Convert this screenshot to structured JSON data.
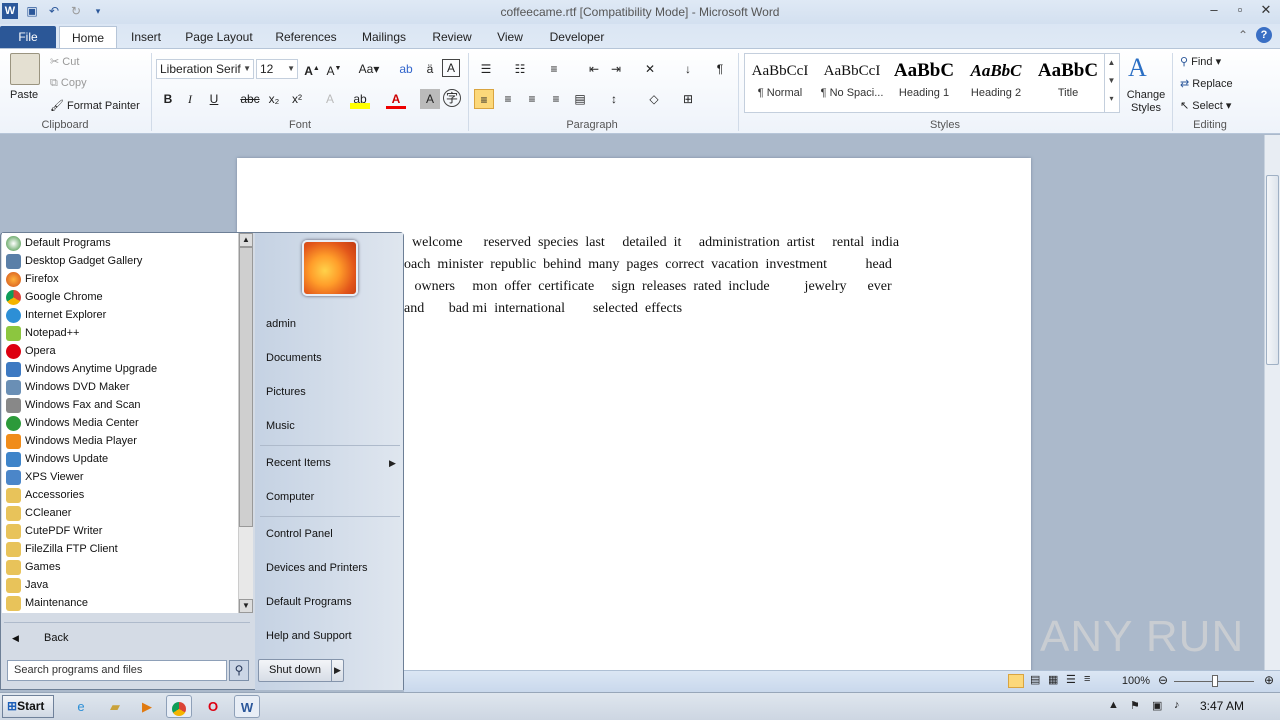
{
  "window": {
    "title": "coffeecame.rtf [Compatibility Mode] - Microsoft Word"
  },
  "tabs": [
    "File",
    "Home",
    "Insert",
    "Page Layout",
    "References",
    "Mailings",
    "Review",
    "View",
    "Developer"
  ],
  "clipboard": {
    "paste": "Paste",
    "cut": "Cut",
    "copy": "Copy",
    "format_painter": "Format Painter",
    "label": "Clipboard"
  },
  "font": {
    "name": "Liberation Serif",
    "size": "12",
    "label": "Font"
  },
  "paragraph": {
    "label": "Paragraph"
  },
  "styles": {
    "label": "Styles",
    "items": [
      {
        "preview": "AaBbCcI",
        "name": "¶ Normal"
      },
      {
        "preview": "AaBbCcI",
        "name": "¶ No Spaci..."
      },
      {
        "preview": "AaBbC",
        "name": "Heading 1"
      },
      {
        "preview": "AaBbC",
        "name": "Heading 2"
      },
      {
        "preview": "AaBbC",
        "name": "Title"
      }
    ],
    "change": "Change Styles"
  },
  "editing": {
    "label": "Editing",
    "find": "Find",
    "replace": "Replace",
    "select": "Select"
  },
  "document": {
    "lines": [
      "welcome      reserved  species  last     detailed  it     administration  artist     rental  india",
      "oach  minister  republic  behind  many  pages  correct  vacation  investment           head",
      "   owners     mon  offer  certificate     sign  releases  rated  include          jewelry      ever",
      "and       bad mi  international        selected  effects"
    ]
  },
  "status": {
    "zoom": "100%"
  },
  "start_menu": {
    "programs": [
      "Default Programs",
      "Desktop Gadget Gallery",
      "Firefox",
      "Google Chrome",
      "Internet Explorer",
      "Notepad++",
      "Opera",
      "Windows Anytime Upgrade",
      "Windows DVD Maker",
      "Windows Fax and Scan",
      "Windows Media Center",
      "Windows Media Player",
      "Windows Update",
      "XPS Viewer",
      "Accessories",
      "CCleaner",
      "CutePDF Writer",
      "FileZilla FTP Client",
      "Games",
      "Java",
      "Maintenance"
    ],
    "back": "Back",
    "search_placeholder": "Search programs and files",
    "right": [
      "admin",
      "Documents",
      "Pictures",
      "Music",
      "Recent Items",
      "Computer",
      "Control Panel",
      "Devices and Printers",
      "Default Programs",
      "Help and Support"
    ],
    "shutdown": "Shut down"
  },
  "taskbar": {
    "start": "Start",
    "clock": "3:47 AM"
  },
  "watermark": "ANY RUN"
}
